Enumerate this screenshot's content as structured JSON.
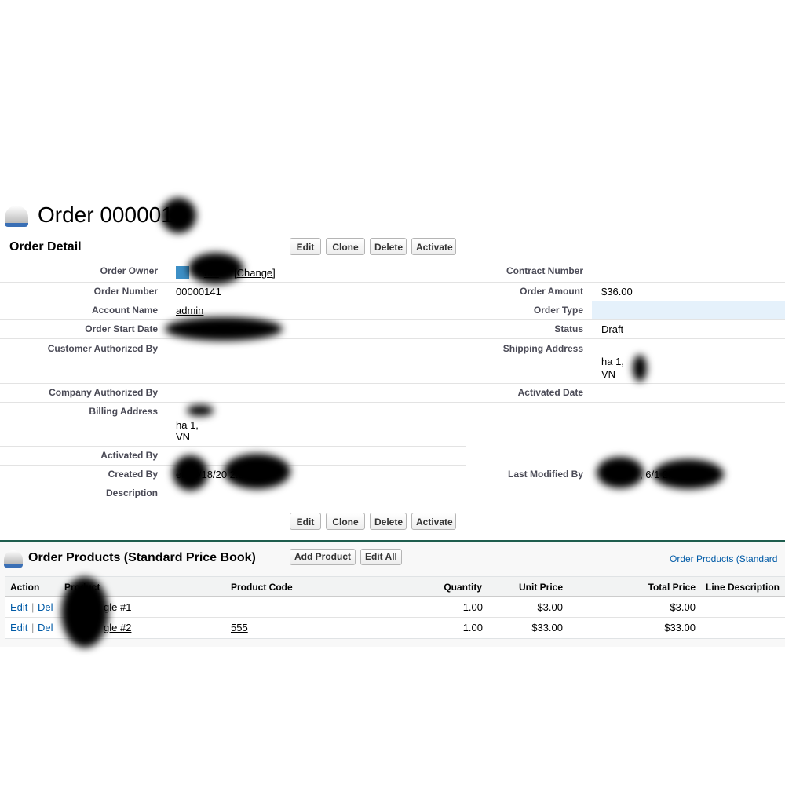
{
  "header": {
    "title": "Order 000001"
  },
  "detail": {
    "heading": "Order Detail",
    "buttons": [
      "Edit",
      "Clone",
      "Delete",
      "Activate"
    ],
    "labels": {
      "owner": "Order Owner",
      "number": "Order Number",
      "account": "Account Name",
      "start": "Order Start Date",
      "cust_auth": "Customer Authorized By",
      "comp_auth": "Company Authorized By",
      "billing": "Billing Address",
      "activated_by": "Activated By",
      "created_by": "Created By",
      "description": "Description",
      "contract": "Contract Number",
      "amount": "Order Amount",
      "type": "Order Type",
      "status": "Status",
      "shipping": "Shipping Address",
      "activated_date": "Activated Date",
      "modified_by": "Last Modified By"
    },
    "values": {
      "owner_change": "[Change]",
      "owner_name": "ner",
      "number": "00000141",
      "account": "admin",
      "amount": "$36.00",
      "status": "Draft",
      "shipping_1": "ha 1,",
      "shipping_2": "VN",
      "billing_1": "ha 1,",
      "billing_2": "VN",
      "created_by": "en, 6/18/20  2:34 AM",
      "modified_by": ", 6/1   2:34 AM"
    }
  },
  "products": {
    "heading": "Order Products (Standard Price Book)",
    "add": "Add Product",
    "edit_all": "Edit All",
    "link": "Order Products (Standard",
    "columns": [
      "Action",
      "Product",
      "Product Code",
      "Quantity",
      "Unit Price",
      "Total Price",
      "Line Description"
    ],
    "rows": [
      {
        "edit": "Edit",
        "del": "Del",
        "product": "gle #1",
        "code": "_",
        "qty": "1.00",
        "unit": "$3.00",
        "total": "$3.00"
      },
      {
        "edit": "Edit",
        "del": "Del",
        "product": "gle #2",
        "code": "555",
        "qty": "1.00",
        "unit": "$33.00",
        "total": "$33.00"
      }
    ]
  }
}
